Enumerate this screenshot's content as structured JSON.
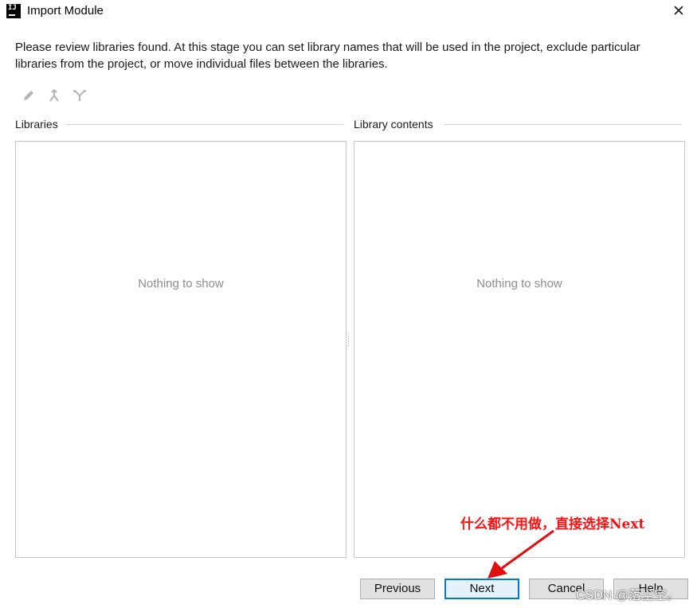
{
  "window": {
    "title": "Import Module",
    "icon_text": "IJ",
    "close_symbol": "✕"
  },
  "description": "Please review libraries found. At this stage you can set library names that will be used in the project, exclude particular libraries from the project, or move individual files between the libraries.",
  "toolbar": {
    "icons": [
      "edit-icon",
      "merge-icon",
      "split-icon"
    ]
  },
  "libraries": {
    "label": "Libraries",
    "empty_text": "Nothing to show"
  },
  "library_contents": {
    "label": "Library contents",
    "empty_text": "Nothing to show"
  },
  "buttons": {
    "previous": "Previous",
    "next": "Next",
    "cancel": "Cancel",
    "help": "Help"
  },
  "annotation": {
    "text": "什么都不用做，直接选择Next",
    "color": "#ff1010"
  },
  "watermark": "CSDN @落尘空。"
}
